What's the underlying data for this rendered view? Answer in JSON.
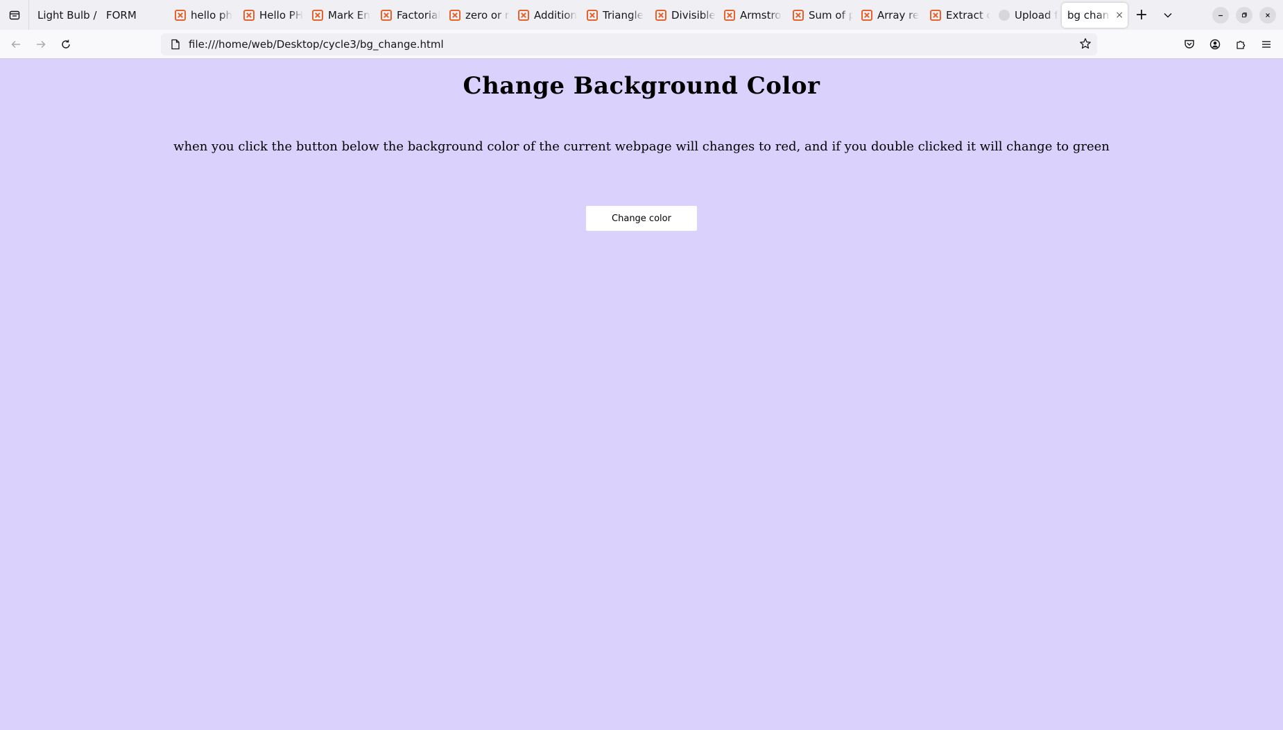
{
  "browser": {
    "tabs": [
      {
        "label": "Light Bulb /",
        "icon": "none"
      },
      {
        "label": "FORM",
        "icon": "none"
      },
      {
        "label": "hello ph",
        "icon": "xampp-icon"
      },
      {
        "label": "Hello PH",
        "icon": "xampp-icon"
      },
      {
        "label": "Mark En",
        "icon": "xampp-icon"
      },
      {
        "label": "Factorial",
        "icon": "xampp-icon"
      },
      {
        "label": "zero or n",
        "icon": "xampp-icon"
      },
      {
        "label": "Addition",
        "icon": "xampp-icon"
      },
      {
        "label": "Triangle",
        "icon": "xampp-icon"
      },
      {
        "label": "Divisible",
        "icon": "xampp-icon"
      },
      {
        "label": "Armstro",
        "icon": "xampp-icon"
      },
      {
        "label": "Sum of p",
        "icon": "xampp-icon"
      },
      {
        "label": "Array re",
        "icon": "xampp-icon"
      },
      {
        "label": "Extract c",
        "icon": "xampp-icon"
      },
      {
        "label": "Upload f",
        "icon": "github-icon"
      }
    ],
    "active_tab": {
      "label": "bg chang",
      "close": "×"
    },
    "new_tab": "+",
    "address": "file:///home/web/Desktop/cycle3/bg_change.html"
  },
  "page": {
    "title": "Change Background Color",
    "description": "when you click the button below the background color of the current webpage will changes to red, and if you double clicked it will change to green",
    "button_label": "Change color"
  },
  "colors": {
    "page_background": "#dad2fd",
    "tabbar_background": "#f0f0f4",
    "xampp_accent": "#e4622b"
  }
}
